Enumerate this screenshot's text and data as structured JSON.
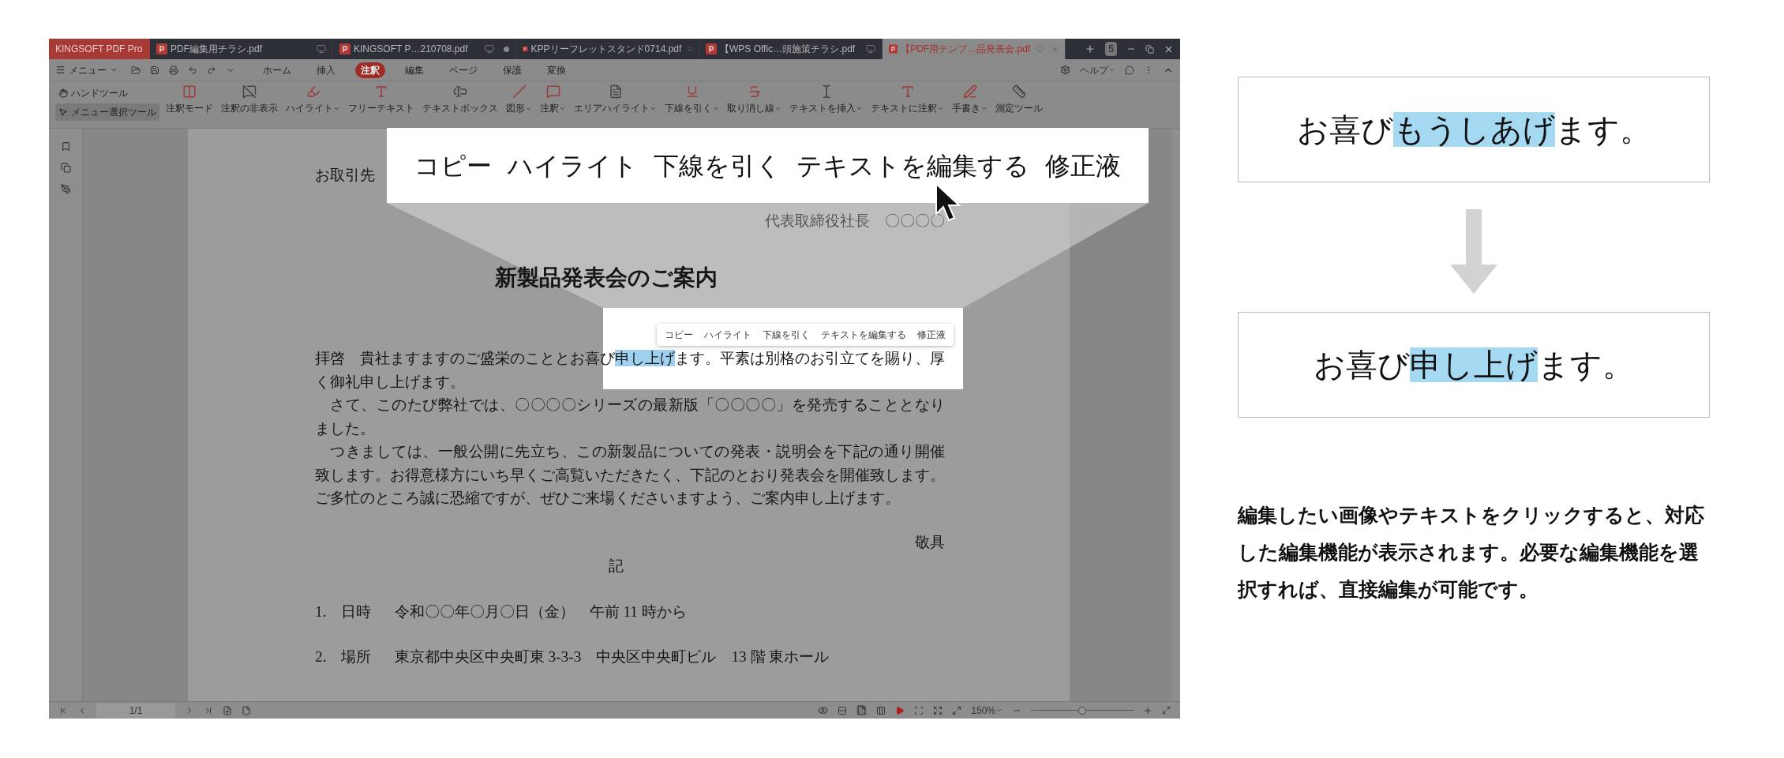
{
  "tabs": [
    {
      "label": "KINGSOFT PDF Pro",
      "kind": "app",
      "selected": false
    },
    {
      "label": "PDF編集用チラシ.pdf",
      "kind": "file",
      "selected": false,
      "modified": false
    },
    {
      "label": "KINGSOFT P…210708.pdf",
      "kind": "file",
      "selected": false,
      "modified": true
    },
    {
      "label": "KPPリーフレットスタンド0714.pdf",
      "kind": "file",
      "selected": false,
      "modified": false
    },
    {
      "label": "【WPS Offic…頭施策チラシ.pdf",
      "kind": "file",
      "selected": false,
      "modified": false
    },
    {
      "label": "【PDF用テンプ…品発表会.pdf",
      "kind": "file",
      "selected": true,
      "modified": false
    }
  ],
  "tab_count": "5",
  "menu": {
    "label": "メニュー"
  },
  "ribbon_tabs": [
    {
      "label": "ホーム",
      "selected": false
    },
    {
      "label": "挿入",
      "selected": false
    },
    {
      "label": "注釈",
      "selected": true
    },
    {
      "label": "編集",
      "selected": false
    },
    {
      "label": "ページ",
      "selected": false
    },
    {
      "label": "保護",
      "selected": false
    },
    {
      "label": "変換",
      "selected": false
    }
  ],
  "help": "ヘルプ",
  "select_tools": [
    {
      "label": "ハンドツール",
      "selected": false
    },
    {
      "label": "メニュー選択ツール",
      "selected": true
    }
  ],
  "tools": [
    {
      "label": "注釈モード",
      "dropdown": false
    },
    {
      "label": "注釈の非表示",
      "dropdown": false
    },
    {
      "label": "ハイライト",
      "dropdown": true
    },
    {
      "label": "フリーテキスト",
      "dropdown": false
    },
    {
      "label": "テキストボックス",
      "dropdown": false
    },
    {
      "label": "図形",
      "dropdown": true
    },
    {
      "label": "注釈",
      "dropdown": true
    },
    {
      "label": "エリアハイライト",
      "dropdown": true
    },
    {
      "label": "下線を引く",
      "dropdown": true
    },
    {
      "label": "取り消し線",
      "dropdown": true
    },
    {
      "label": "テキストを挿入",
      "dropdown": true
    },
    {
      "label": "テキストに注釈",
      "dropdown": true
    },
    {
      "label": "手書き",
      "dropdown": true
    },
    {
      "label": "測定ツール",
      "dropdown": false
    }
  ],
  "document": {
    "addressee": "お取引先",
    "signature": "代表取締役社長　〇〇〇〇",
    "title": "新製品発表会のご案内",
    "paragraphs": [
      {
        "indent": false,
        "segments": [
          {
            "text": "拝啓　貴社ますますのご盛栄のこととお喜び",
            "highlighted": false
          },
          {
            "text": "申し上げ",
            "highlighted": true
          },
          {
            "text": "ます。平素は別格のお引立てを賜り、厚く御礼申し上げます。",
            "highlighted": false
          }
        ]
      },
      {
        "indent": true,
        "segments": [
          {
            "text": "さて、このたび弊社では、〇〇〇〇シリーズの最新版「〇〇〇〇」を発売することとなりました。",
            "highlighted": false
          }
        ]
      },
      {
        "indent": true,
        "segments": [
          {
            "text": "つきましては、一般公開に先立ち、この新製品についての発表・説明会を下記の通り開催致します。お得意様方にいち早くご高覧いただきたく、下記のとおり発表会を開催致します。ご多忙のところ誠に恐縮ですが、ぜひご来場くださいますよう、ご案内申し上げます。",
            "highlighted": false
          }
        ]
      }
    ],
    "closing": "敬具",
    "note_heading": "記",
    "items": [
      {
        "number": "1.",
        "label": "日時",
        "value": "令和〇〇年〇月〇日（金）　午前 11 時から"
      },
      {
        "number": "2.",
        "label": "場所",
        "value": "東京都中央区中央町東 3-3-3　中央区中央町ビル　13 階 東ホール"
      }
    ]
  },
  "context_menu": [
    "コピー",
    "ハイライト",
    "下線を引く",
    "テキストを編集する",
    "修正液"
  ],
  "zoom_callout": [
    "コピー",
    "ハイライト",
    "下線を引く",
    "テキストを編集する",
    "修正液"
  ],
  "status_bar": {
    "page": "1/1",
    "zoom": "150%",
    "level": 0.5
  },
  "examples": [
    {
      "segments": [
        {
          "text": "お喜び",
          "highlighted": false
        },
        {
          "text": "もうしあげ",
          "highlighted": true
        },
        {
          "text": "ます。",
          "highlighted": false
        }
      ]
    },
    {
      "segments": [
        {
          "text": "お喜び",
          "highlighted": false
        },
        {
          "text": "申し上げ",
          "highlighted": true
        },
        {
          "text": "ます。",
          "highlighted": false
        }
      ]
    }
  ],
  "description": "編集したい画像やテキストをクリックすると、対応した編集機能が表示されます。必要な編集機能を選択すれば、直接編集が可能です。"
}
